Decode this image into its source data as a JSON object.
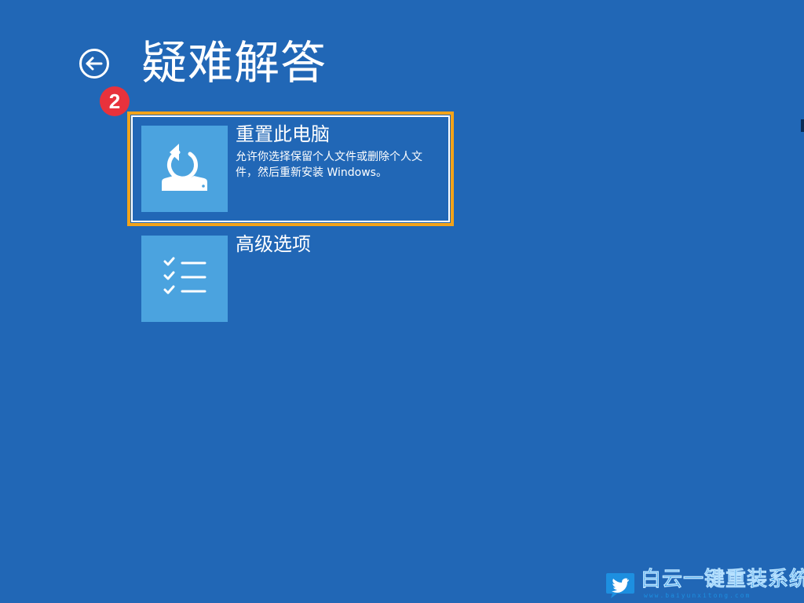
{
  "header": {
    "title": "疑难解答",
    "back_icon": "back-arrow-icon"
  },
  "annotation": {
    "step_number": "2",
    "badge_color": "#e8323c",
    "highlight_color": "#f2a31a"
  },
  "options": [
    {
      "title": "重置此电脑",
      "description": "允许你选择保留个人文件或删除个人文件，然后重新安装 Windows。",
      "icon": "reset-pc-icon",
      "selected": true
    },
    {
      "title": "高级选项",
      "description": "",
      "icon": "checklist-icon",
      "selected": false
    }
  ],
  "watermark": {
    "text": "白云一键重装系统",
    "url_text": "www.baiyunxitong.com",
    "logo_icon": "twitter-bird-icon"
  },
  "colors": {
    "background": "#2167b6",
    "tile": "#4ba3df",
    "text": "#ffffff"
  }
}
